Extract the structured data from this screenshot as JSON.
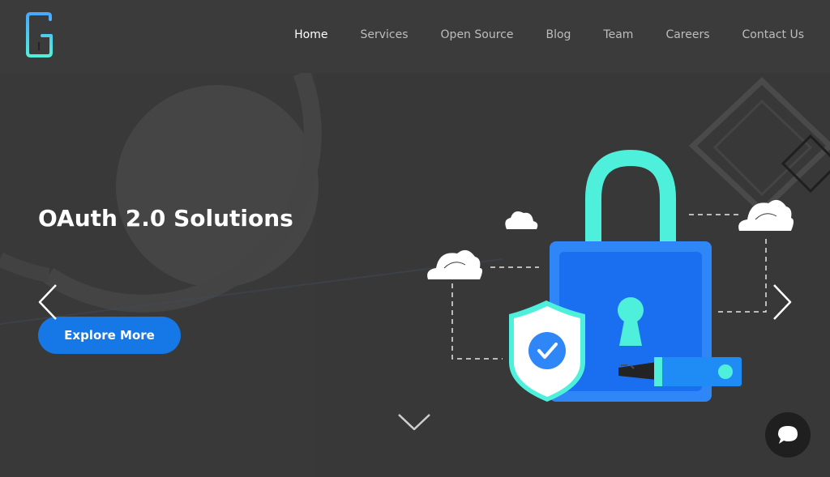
{
  "header": {
    "logo_icon": "g-logo-icon",
    "nav": [
      {
        "label": "Home",
        "active": true
      },
      {
        "label": "Services",
        "active": false
      },
      {
        "label": "Open Source",
        "active": false
      },
      {
        "label": "Blog",
        "active": false
      },
      {
        "label": "Team",
        "active": false
      },
      {
        "label": "Careers",
        "active": false
      },
      {
        "label": "Contact Us",
        "active": false
      }
    ]
  },
  "hero": {
    "title": "OAuth 2.0 Solutions",
    "cta_label": "Explore More",
    "illustration_icon": "padlock-security-illustration",
    "prev_icon": "chevron-left-icon",
    "next_icon": "chevron-right-icon",
    "scroll_icon": "chevron-down-icon"
  },
  "chat": {
    "icon": "chat-bubble-icon"
  },
  "colors": {
    "background": "#383838",
    "header": "#3b3b3b",
    "accent_blue": "#1677e6",
    "teal": "#4ef0dc",
    "lock_blue": "#2f86f6"
  }
}
